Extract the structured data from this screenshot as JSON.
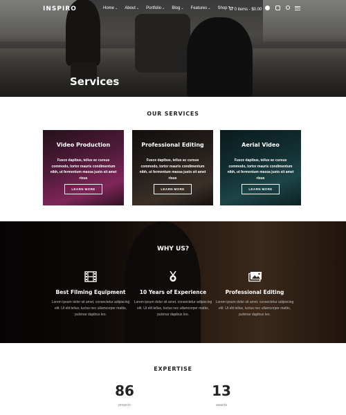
{
  "nav": {
    "logo": "INSPIRO",
    "menu": [
      {
        "label": "Home",
        "caret": "⌄"
      },
      {
        "label": "About",
        "caret": "⌄"
      },
      {
        "label": "Portfolio",
        "caret": "⌄"
      },
      {
        "label": "Blog",
        "caret": "⌄"
      },
      {
        "label": "Features",
        "caret": "⌄"
      },
      {
        "label": "Shop",
        "caret": ""
      }
    ],
    "cart": "0 items - $0.00",
    "icons": [
      "cart-icon",
      "facebook-icon",
      "instagram-icon",
      "search-icon",
      "menu-icon"
    ]
  },
  "hero": {
    "title": "Services"
  },
  "services": {
    "title": "OUR SERVICES",
    "cards": [
      {
        "title": "Video Production",
        "text": "Fusce dapibus, tellus ac cursus commodo, tortor mauris condimentum nibh, ut fermentum massa justo sit amet risus",
        "button": "LEARN MORE"
      },
      {
        "title": "Professional Editing",
        "text": "Fusce dapibus, tellus ac cursus commodo, tortor mauris condimentum nibh, ut fermentum massa justo sit amet risus",
        "button": "LEARN MORE"
      },
      {
        "title": "Aerial Video",
        "text": "Fusce dapibus, tellus ac cursus commodo, tortor mauris condimentum nibh, ut fermentum massa justo sit amet risus",
        "button": "LEARN MORE"
      }
    ]
  },
  "why": {
    "title": "WHY US?",
    "features": [
      {
        "icon": "film-icon",
        "title": "Best Filming Equipment",
        "text": "Lorem ipsum dolor sit amet, consectetur adipiscing elit. Ut elit tellus, luctus nec ullamcorper mattis, pulvinar dapibus leo."
      },
      {
        "icon": "medal-icon",
        "title": "10 Years of Experience",
        "text": "Lorem ipsum dolor sit amet, consectetur adipiscing elit. Ut elit tellus, luctus nec ullamcorper mattis, pulvinar dapibus leo."
      },
      {
        "icon": "photo-edit-icon",
        "title": "Professional Editing",
        "text": "Lorem ipsum dolor sit amet, consectetur adipiscing elit. Ut elit tellus, luctus nec ullamcorper mattis, pulvinar dapibus leo."
      }
    ]
  },
  "expertise": {
    "title": "EXPERTISE",
    "stats": [
      {
        "value": "86",
        "label": "projects"
      },
      {
        "value": "13",
        "label": "awards"
      }
    ]
  }
}
